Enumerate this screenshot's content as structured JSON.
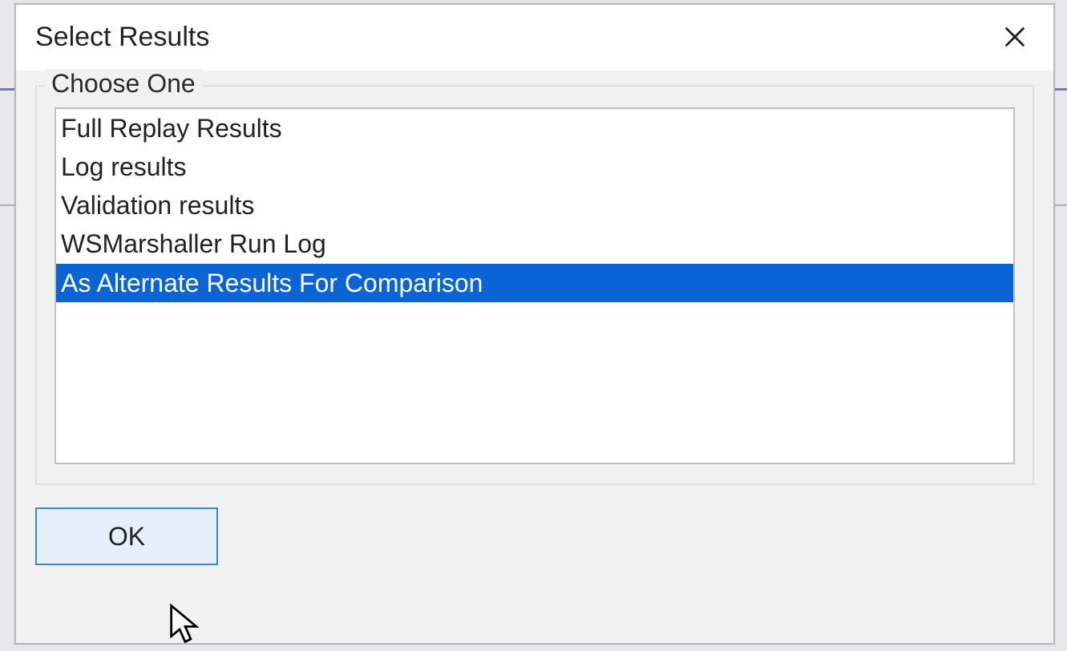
{
  "dialog": {
    "title": "Select Results",
    "groupLabel": "Choose One",
    "items": [
      {
        "label": "Full Replay Results",
        "selected": false
      },
      {
        "label": "Log results",
        "selected": false
      },
      {
        "label": "Validation results",
        "selected": false
      },
      {
        "label": "WSMarshaller Run Log",
        "selected": false
      },
      {
        "label": "As Alternate Results For Comparison",
        "selected": true
      }
    ],
    "okLabel": "OK"
  },
  "colors": {
    "selectionBg": "#0a64d6",
    "buttonBorder": "#3a88c9",
    "buttonBg": "#e6f0fa"
  }
}
